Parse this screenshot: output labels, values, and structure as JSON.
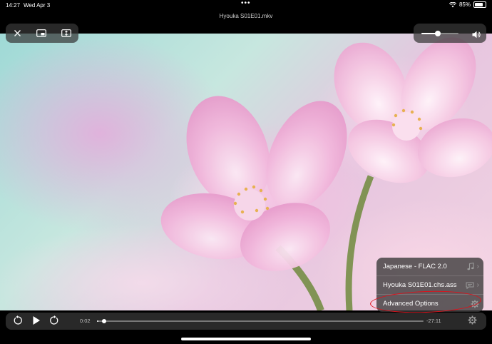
{
  "status_bar": {
    "time": "14:27",
    "date": "Wed Apr 3",
    "battery": "85%"
  },
  "title": "Hyouka S01E01.mkv",
  "top_controls": {
    "close_icon": "close-icon",
    "pip_icon": "picture-in-picture-icon",
    "aspect_icon": "aspect-ratio-icon"
  },
  "volume": {
    "level": 0.45,
    "icon": "speaker-icon"
  },
  "menu": {
    "items": [
      {
        "label": "Japanese - FLAC 2.0",
        "icon": "music-note-icon"
      },
      {
        "label": "Hyouka S01E01.chs.ass",
        "icon": "subtitle-bubble-icon"
      },
      {
        "label": "Advanced Options",
        "icon": "gear-icon"
      }
    ]
  },
  "playback": {
    "elapsed": "0:02",
    "remaining": "-27:11",
    "progress": 0.005
  },
  "colors": {
    "annotation": "#e0101a",
    "panel": "#373737"
  }
}
